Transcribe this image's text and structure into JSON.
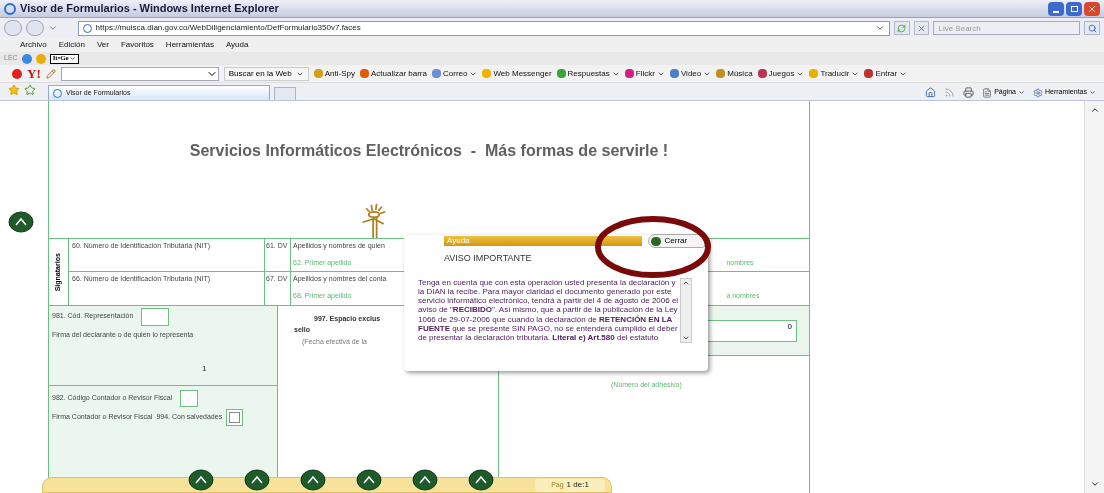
{
  "window": {
    "title": "Visor de Formularios - Windows Internet Explorer"
  },
  "address_bar": {
    "url": "https://muisca.dian.gov.co/WebDiligenciamiento/DefFormulario350v7.faces"
  },
  "search": {
    "placeholder": "Live Search"
  },
  "menu": [
    "Archivo",
    "Edición",
    "Ver",
    "Favoritos",
    "Herramientas",
    "Ayuda"
  ],
  "links_bar": {
    "label": "LEC",
    "dropdown": "It•Ge"
  },
  "toolbar": {
    "logo": "Y!",
    "search_button": "Buscar en la Web",
    "items": [
      {
        "label": "Anti-Spy",
        "dropdown": false
      },
      {
        "label": "Actualizar barra",
        "dropdown": false
      },
      {
        "label": "Correo",
        "dropdown": true
      },
      {
        "label": "Web Messenger",
        "dropdown": false
      },
      {
        "label": "Respuestas",
        "dropdown": true
      },
      {
        "label": "Flickr",
        "dropdown": true
      },
      {
        "label": "Video",
        "dropdown": true
      },
      {
        "label": "Música",
        "dropdown": false
      },
      {
        "label": "Juegos",
        "dropdown": true
      },
      {
        "label": "Traducir",
        "dropdown": true
      },
      {
        "label": "Entrar",
        "dropdown": true
      }
    ]
  },
  "tabs": [
    {
      "label": "Visor de Formularios",
      "selected": true
    }
  ],
  "command_bar": [
    "Página",
    "Herramientas"
  ],
  "page": {
    "banner": "Servicios Informáticos Electrónicos  -  Más formas de servirle !"
  },
  "signatories": {
    "label": "Signatarios",
    "rows": [
      {
        "nit": "60. Número de Identificación Tributaria (NIT)",
        "dv": "61. DV",
        "names": "Apellidos y nombres de quien",
        "first_surname": "62. Primer apellido",
        "other": "nombres"
      },
      {
        "nit": "66. Número de Identificación Tributaria (NIT)",
        "dv": "67. DV",
        "names": "Apellidos y nombres del conta",
        "first_surname": "68. Primer apellido",
        "other": "a nombres"
      }
    ]
  },
  "representation": {
    "code_label": "981. Cód. Representación",
    "signature_label": "Firma del declarante o de quien lo representa",
    "value": "1"
  },
  "accountant": {
    "code_label": "982. Código Contador o Revisor Fiscal",
    "signature_label": "Firma Contador o Revisor Fiscal",
    "reservations_label": "994. Con salvedades",
    "reservations_checked": false
  },
  "stamp": {
    "label": "997. Espacio exclus",
    "label_line2": "sello",
    "date_note": "(Fecha efectiva de la"
  },
  "adhesive": {
    "value": "0",
    "note": "(Número del adhesivo)"
  },
  "dialog": {
    "header": "Ayuda",
    "close_button": "Cerrar",
    "title": "AVISO IMPORTANTE",
    "body": "Tenga en cuenta que con esta operación usted presenta la declaración y la DIAN la recibe. Para mayor claridad el documento generado por este servicio informático electrónico, tendrá a partir del 4 de agosto de 2006 el aviso de \"**RECIBIDO**\". Así mismo, que a partir de la publicación de la Ley 1066 de 29-07-2006 que cuando la declaración de **RETENCIÓN EN LA FUENTE** que se presente SIN PAGO, no se entenderá cumplido el deber de presentar la declaración tributaria. **Literal e) Art.580** del estatuto"
  },
  "pager": {
    "label": "Pag",
    "value": "1 de:1"
  }
}
